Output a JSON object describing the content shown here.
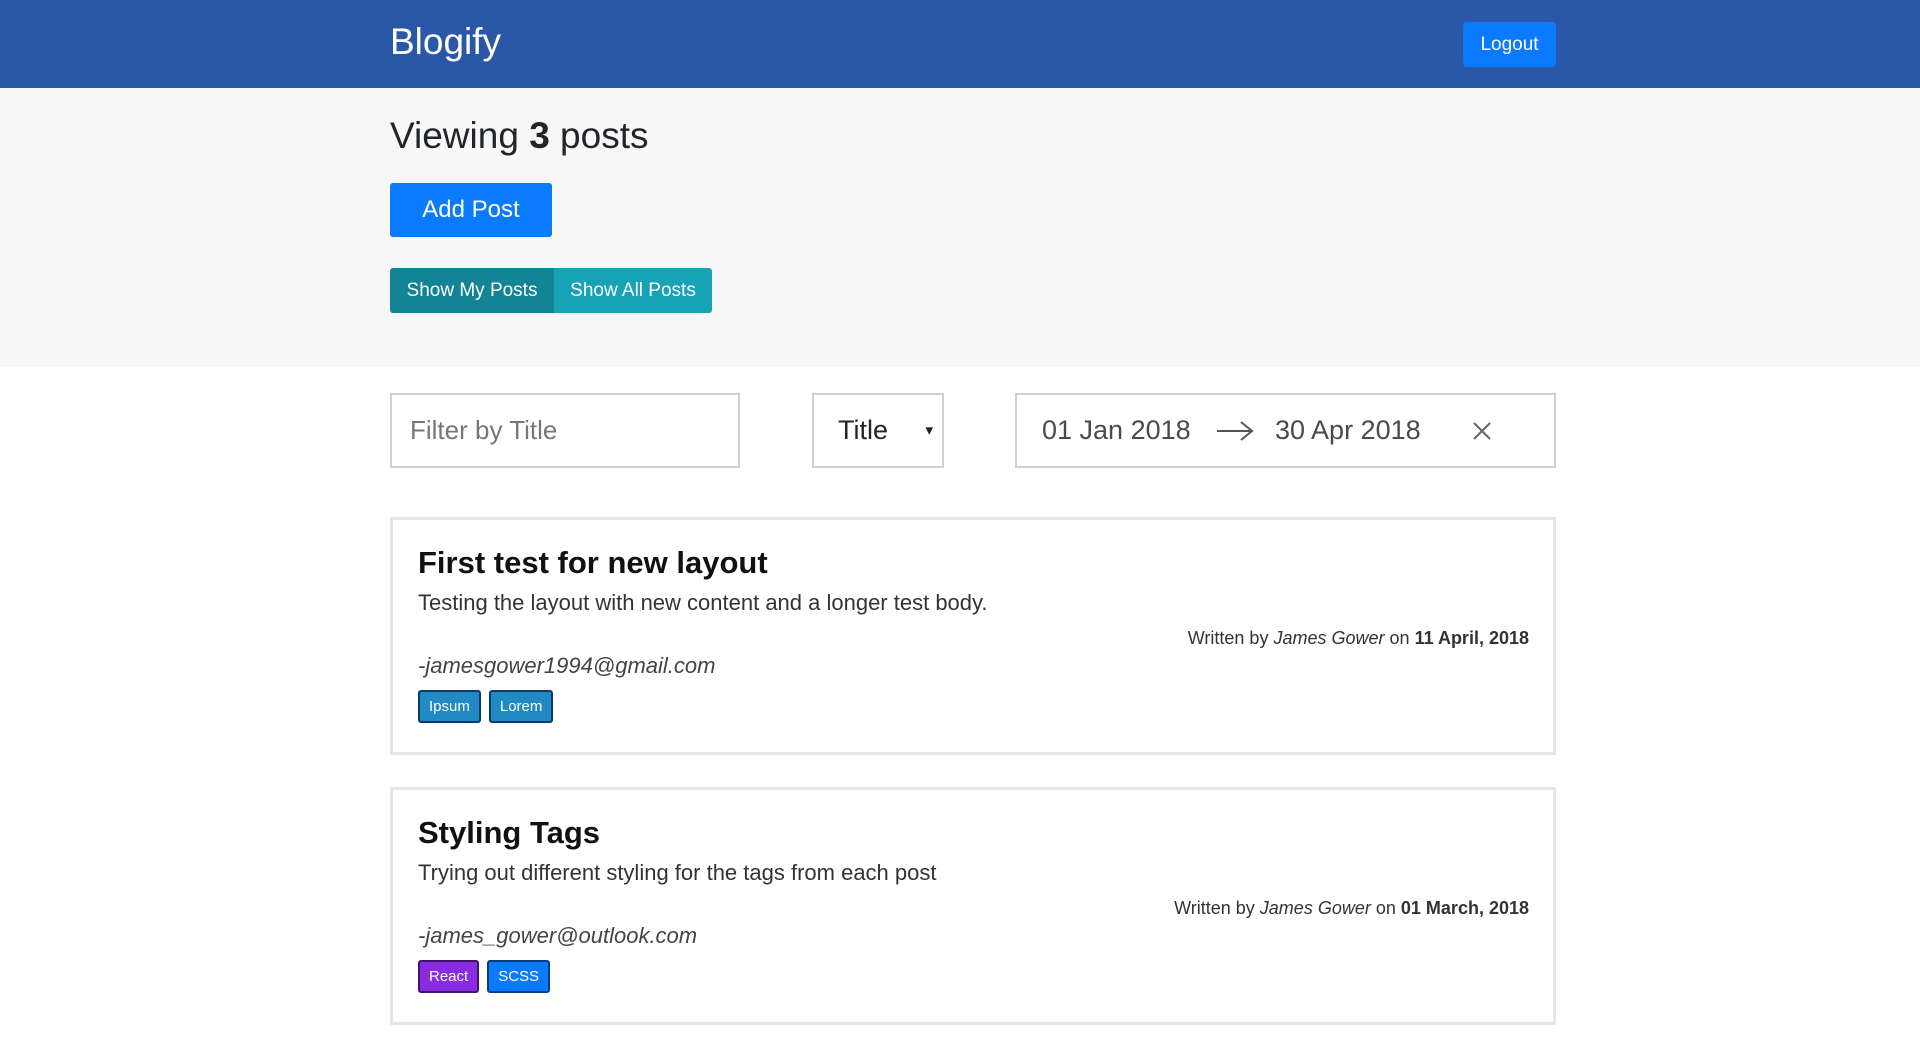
{
  "navbar": {
    "brand": "Blogify",
    "logout_label": "Logout"
  },
  "hero": {
    "viewing_prefix": "Viewing",
    "post_count": "3",
    "viewing_suffix": "posts",
    "add_post_label": "Add Post",
    "show_my_posts_label": "Show My Posts",
    "show_all_posts_label": "Show All Posts"
  },
  "filters": {
    "title_placeholder": "Filter by Title",
    "title_value": "",
    "sort_selected": "Title",
    "date_start": "01 Jan 2018",
    "date_end": "30 Apr 2018"
  },
  "colors": {
    "navbar": "#2a57a8",
    "primary": "#0a7bff",
    "info_dark": "#138496",
    "info": "#17a2b8",
    "tag_blue": "#1f8ac4",
    "tag_purple": "#8a2be2"
  },
  "icons": {
    "caret": "caret-down-icon",
    "arrow": "arrow-right-icon",
    "clear": "close-icon"
  },
  "posts": [
    {
      "title": "First test for new layout",
      "body": "Testing the layout with new content and a longer test body.",
      "written_by": "Written by",
      "author": "James Gower",
      "on": "on",
      "date": "11 April, 2018",
      "email": "-jamesgower1994@gmail.com",
      "tags": [
        "Ipsum",
        "Lorem"
      ]
    },
    {
      "title": "Styling Tags",
      "body": "Trying out different styling for the tags from each post",
      "written_by": "Written by",
      "author": "James Gower",
      "on": "on",
      "date": "01 March, 2018",
      "email": "-james_gower@outlook.com",
      "tags": [
        "React",
        "SCSS"
      ]
    }
  ]
}
